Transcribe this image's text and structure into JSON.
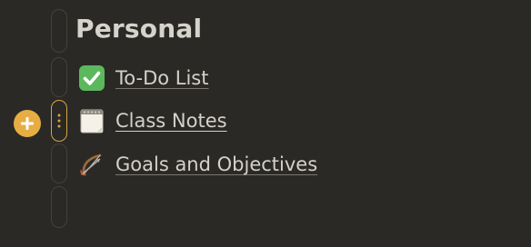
{
  "page": {
    "title": "Personal"
  },
  "items": [
    {
      "label": "To-Do List",
      "icon": "check-mark-button-icon"
    },
    {
      "label": "Class Notes",
      "icon": "notepad-icon"
    },
    {
      "label": "Goals and Objectives",
      "icon": "bow-and-arrow-icon"
    }
  ],
  "colors": {
    "background": "#2b2926",
    "accent": "#e7ad45",
    "check_green": "#5cb85c",
    "text": "#d4d1cb"
  }
}
